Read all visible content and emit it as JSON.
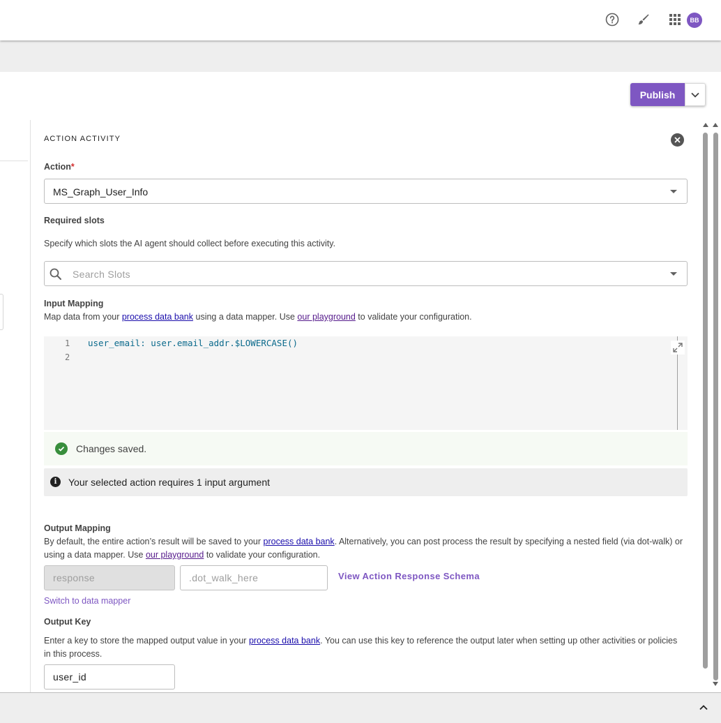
{
  "header": {
    "avatar_initials": "BB",
    "icons": [
      "help-circle-icon",
      "brush-icon",
      "apps-grid-icon"
    ]
  },
  "toolbar": {
    "publish_label": "Publish"
  },
  "panel": {
    "title": "ACTION ACTIVITY",
    "action": {
      "label": "Action",
      "required_mark": "*",
      "selected": "MS_Graph_User_Info"
    },
    "required_slots": {
      "label": "Required slots",
      "help": "Specify which slots the AI agent should collect before executing this activity.",
      "search_placeholder": "Search Slots"
    },
    "input_mapping": {
      "label": "Input Mapping",
      "help_prefix": "Map data from your ",
      "help_link1": "process data bank",
      "help_mid": " using a data mapper. Use ",
      "help_link2": "our playground",
      "help_suffix": " to validate your configuration.",
      "lines": [
        {
          "num": "1",
          "code": "user_email: user.email_addr.$LOWERCASE()"
        },
        {
          "num": "2",
          "code": ""
        }
      ]
    },
    "saved_message": "Changes saved.",
    "info_message": "Your selected action requires 1 input argument",
    "output_mapping": {
      "label": "Output Mapping",
      "help_prefix": "By default, the entire action’s result will be saved to your ",
      "help_link1": "process data bank",
      "help_mid": ". Alternatively, you can post process the result by specifying a nested field (via dot-walk) or using a data mapper. Use ",
      "help_link2": "our playground",
      "help_suffix": " to validate your configuration.",
      "response_placeholder": "response",
      "dotwalk_placeholder": ".dot_walk_here",
      "view_schema_label": "View Action Response Schema",
      "switch_label": "Switch to data mapper"
    },
    "output_key": {
      "label": "Output Key",
      "help_prefix": "Enter a key to store the mapped output value in your ",
      "help_link": "process data bank",
      "help_suffix": ". You can use this key to reference the output later when setting up other activities or policies in this process.",
      "value": "user_id"
    }
  },
  "colors": {
    "accent": "#7e57c2",
    "success": "#388e3c",
    "link": "#1a0dab",
    "visited_link": "#551a8b",
    "required": "#d32f2f"
  }
}
